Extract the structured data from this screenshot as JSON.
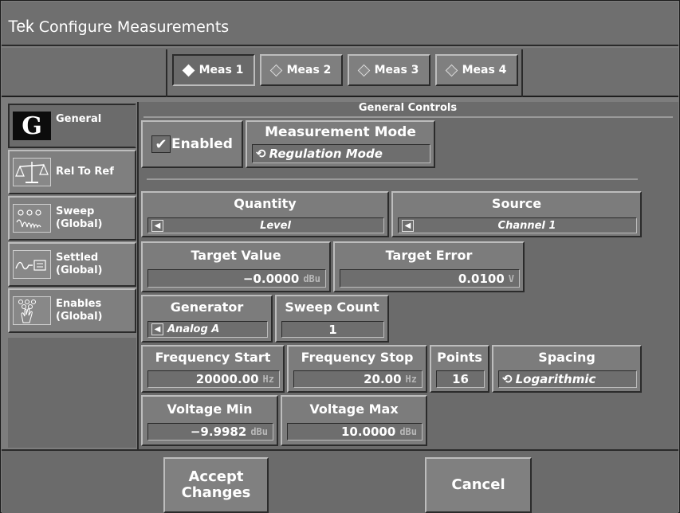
{
  "window": {
    "brand": "Tek",
    "title": "Configure Measurements"
  },
  "meas_tabs": [
    {
      "label": "Meas 1",
      "selected": true
    },
    {
      "label": "Meas 2",
      "selected": false
    },
    {
      "label": "Meas 3",
      "selected": false
    },
    {
      "label": "Meas 4",
      "selected": false
    }
  ],
  "nav": [
    {
      "label": "General",
      "icon": "g-letter-icon",
      "active": true
    },
    {
      "label": "Rel To Ref",
      "icon": "scale-icon",
      "active": false
    },
    {
      "label": "Sweep\n(Global)",
      "icon": "sweep-icon",
      "active": false
    },
    {
      "label": "Settled\n(Global)",
      "icon": "settled-icon",
      "active": false
    },
    {
      "label": "Enables\n(Global)",
      "icon": "enables-icon",
      "active": false
    }
  ],
  "section": {
    "header": "General Controls"
  },
  "enabled": {
    "label": "Enabled",
    "checked": true
  },
  "measurement_mode": {
    "label": "Measurement Mode",
    "value": "Regulation Mode"
  },
  "quantity": {
    "label": "Quantity",
    "value": "Level"
  },
  "source": {
    "label": "Source",
    "value": "Channel 1"
  },
  "target_value": {
    "label": "Target Value",
    "value": "−0.0000",
    "unit": "dBu"
  },
  "target_error": {
    "label": "Target Error",
    "value": "0.0100",
    "unit": "V"
  },
  "generator": {
    "label": "Generator",
    "value": "Analog A"
  },
  "sweep_count": {
    "label": "Sweep Count",
    "value": "1"
  },
  "freq_start": {
    "label": "Frequency Start",
    "value": "20000.00",
    "unit": "Hz"
  },
  "freq_stop": {
    "label": "Frequency Stop",
    "value": "20.00",
    "unit": "Hz"
  },
  "points": {
    "label": "Points",
    "value": "16"
  },
  "spacing": {
    "label": "Spacing",
    "value": "Logarithmic"
  },
  "voltage_min": {
    "label": "Voltage Min",
    "value": "−9.9982",
    "unit": "dBu"
  },
  "voltage_max": {
    "label": "Voltage Max",
    "value": "10.0000",
    "unit": "dBu"
  },
  "buttons": {
    "accept": "Accept\nChanges",
    "cancel": "Cancel"
  },
  "colors": {
    "background": "#6b6b6b",
    "text": "#ffffff",
    "unit_text": "#b8b8b8"
  }
}
